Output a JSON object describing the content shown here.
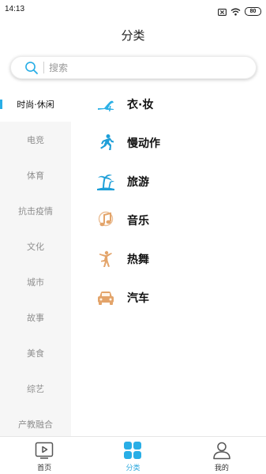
{
  "status_bar": {
    "time": "14:13",
    "battery": "80"
  },
  "header": {
    "title": "分类"
  },
  "search": {
    "placeholder": "搜索",
    "value": ""
  },
  "sidebar": {
    "items": [
      {
        "label": "时尚·休闲",
        "active": true
      },
      {
        "label": "电竞"
      },
      {
        "label": "体育"
      },
      {
        "label": "抗击疫情"
      },
      {
        "label": "文化"
      },
      {
        "label": "城市"
      },
      {
        "label": "故事"
      },
      {
        "label": "美食"
      },
      {
        "label": "综艺"
      },
      {
        "label": "产教融合"
      }
    ]
  },
  "categories": [
    {
      "label": "衣·妆",
      "icon": "high-heel-icon"
    },
    {
      "label": "慢动作",
      "icon": "runner-icon"
    },
    {
      "label": "旅游",
      "icon": "palm-tree-icon"
    },
    {
      "label": "音乐",
      "icon": "music-note-icon"
    },
    {
      "label": "热舞",
      "icon": "dancer-icon"
    },
    {
      "label": "汽车",
      "icon": "car-icon"
    }
  ],
  "tabbar": {
    "items": [
      {
        "label": "首页",
        "icon": "play-screen-icon"
      },
      {
        "label": "分类",
        "icon": "grid-icon",
        "active": true
      },
      {
        "label": "我的",
        "icon": "user-icon"
      }
    ]
  },
  "colors": {
    "accent": "#29aee6",
    "sidebar_bg": "#f6f6f6",
    "icon_warm": "#e3a46a"
  }
}
